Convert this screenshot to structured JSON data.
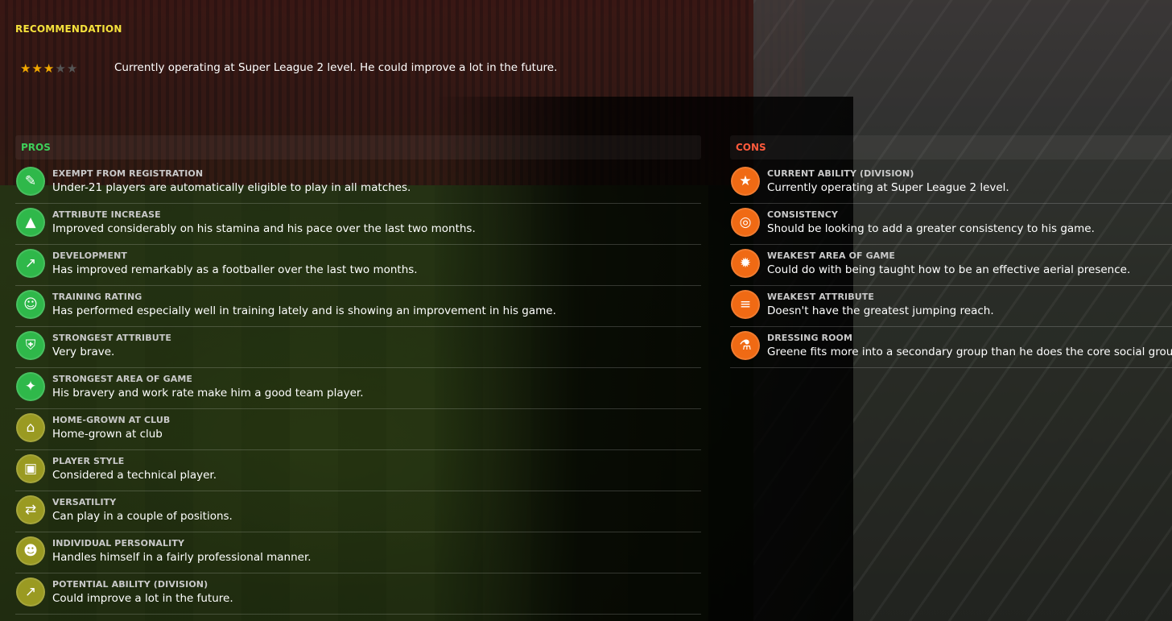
{
  "recommendation": {
    "title": "RECOMMENDATION",
    "stars_filled": 3,
    "stars_total": 5,
    "text": "Currently operating at Super League 2 level. He could improve a lot in the future."
  },
  "pros": {
    "title": "PROS",
    "items": [
      {
        "title": "EXEMPT FROM REGISTRATION",
        "desc": "Under-21 players are automatically eligible to play in all matches.",
        "icon": "registration-icon",
        "color": "green"
      },
      {
        "title": "ATTRIBUTE INCREASE",
        "desc": "Improved considerably on his stamina and his pace over the last two months.",
        "icon": "attribute-increase-icon",
        "color": "green"
      },
      {
        "title": "DEVELOPMENT",
        "desc": "Has improved remarkably as a footballer over the last two months.",
        "icon": "development-icon",
        "color": "green"
      },
      {
        "title": "TRAINING RATING",
        "desc": "Has performed especially well in training lately and is showing an improvement in his game.",
        "icon": "training-icon",
        "color": "green"
      },
      {
        "title": "STRONGEST ATTRIBUTE",
        "desc": "Very brave.",
        "icon": "shield-icon",
        "color": "green"
      },
      {
        "title": "STRONGEST AREA OF GAME",
        "desc": "His bravery and work rate make him a good team player.",
        "icon": "bandage-icon",
        "color": "green"
      },
      {
        "title": "HOME-GROWN AT CLUB",
        "desc": "Home-grown at club",
        "icon": "home-grown-icon",
        "color": "olive"
      },
      {
        "title": "PLAYER STYLE",
        "desc": "Considered a technical player.",
        "icon": "pitch-icon",
        "color": "olive"
      },
      {
        "title": "VERSATILITY",
        "desc": "Can play in a couple of positions.",
        "icon": "arrows-icon",
        "color": "olive"
      },
      {
        "title": "INDIVIDUAL PERSONALITY",
        "desc": "Handles himself in a fairly professional manner.",
        "icon": "head-icon",
        "color": "olive"
      },
      {
        "title": "POTENTIAL ABILITY (DIVISION)",
        "desc": "Could improve a lot in the future.",
        "icon": "trend-up-icon",
        "color": "olive"
      }
    ]
  },
  "cons": {
    "title": "CONS",
    "items": [
      {
        "title": "CURRENT ABILITY (DIVISION)",
        "desc": "Currently operating at Super League 2 level.",
        "icon": "star-icon",
        "color": "orange"
      },
      {
        "title": "CONSISTENCY",
        "desc": "Should be looking to add a greater consistency to his game.",
        "icon": "target-icon",
        "color": "orange"
      },
      {
        "title": "WEAKEST AREA OF GAME",
        "desc": "Could do with being taught how to be an effective aerial presence.",
        "icon": "aerial-icon",
        "color": "orange"
      },
      {
        "title": "WEAKEST ATTRIBUTE",
        "desc": "Doesn't have the greatest jumping reach.",
        "icon": "spring-icon",
        "color": "orange"
      },
      {
        "title": "DRESSING ROOM",
        "desc": "Greene fits more into a secondary group than he does the core social group.",
        "icon": "flask-icon",
        "color": "orange"
      }
    ]
  },
  "colors": {
    "recommendation_title": "#f5e23c",
    "pros_title": "#3ecf5a",
    "cons_title": "#ff5a3c",
    "green": "#2fb84a",
    "olive": "#9a9a22",
    "orange": "#f06a14",
    "star_on": "#f2a900"
  }
}
